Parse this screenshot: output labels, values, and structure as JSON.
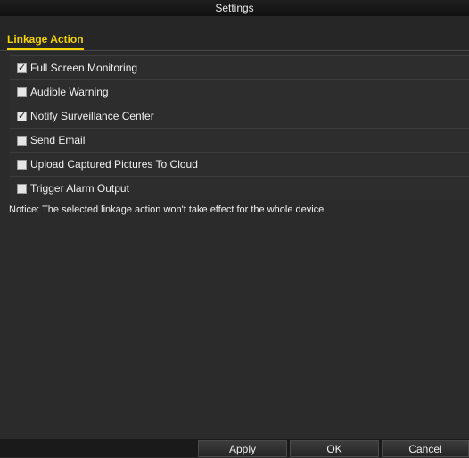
{
  "window": {
    "title": "Settings"
  },
  "tabs": [
    {
      "label": "Linkage Action",
      "active": true
    }
  ],
  "options": [
    {
      "label": "Full Screen Monitoring",
      "checked": true
    },
    {
      "label": "Audible Warning",
      "checked": false
    },
    {
      "label": "Notify Surveillance Center",
      "checked": true
    },
    {
      "label": "Send Email",
      "checked": false
    },
    {
      "label": "Upload Captured Pictures To Cloud",
      "checked": false
    },
    {
      "label": "Trigger Alarm Output",
      "checked": false
    }
  ],
  "notice": "Notice: The selected linkage action won't take effect for the whole device.",
  "buttons": {
    "apply": "Apply",
    "ok": "OK",
    "cancel": "Cancel"
  },
  "colors": {
    "accent": "#f5d400",
    "background": "#2b2b2b"
  }
}
